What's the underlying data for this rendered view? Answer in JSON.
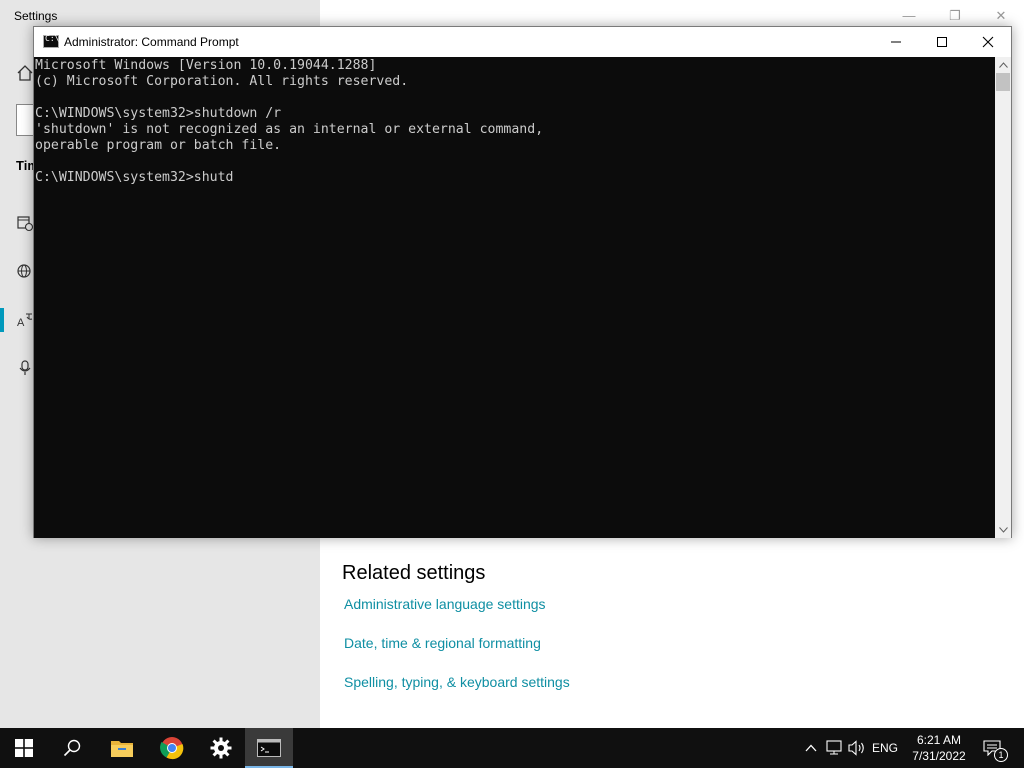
{
  "settings": {
    "title": "Settings",
    "sidebar_heading_fragment": "Tim",
    "related": {
      "title": "Related settings",
      "links": [
        "Administrative language settings",
        "Date, time & regional formatting",
        "Spelling, typing, & keyboard settings"
      ]
    }
  },
  "cmd": {
    "title": "Administrator: Command Prompt",
    "icon_text": "C:\\_",
    "lines": [
      "Microsoft Windows [Version 10.0.19044.1288]",
      "(c) Microsoft Corporation. All rights reserved.",
      "",
      "C:\\WINDOWS\\system32>shutdown /r",
      "'shutdown' is not recognized as an internal or external command,",
      "operable program or batch file.",
      "",
      "C:\\WINDOWS\\system32>shutd"
    ]
  },
  "taskbar": {
    "language": "ENG",
    "time": "6:21 AM",
    "date": "7/31/2022",
    "notification_count": "1"
  },
  "colors": {
    "console_bg": "#0c0c0c",
    "console_text": "#cccccc",
    "link": "#0f8fa3",
    "accent": "#0099bc"
  }
}
